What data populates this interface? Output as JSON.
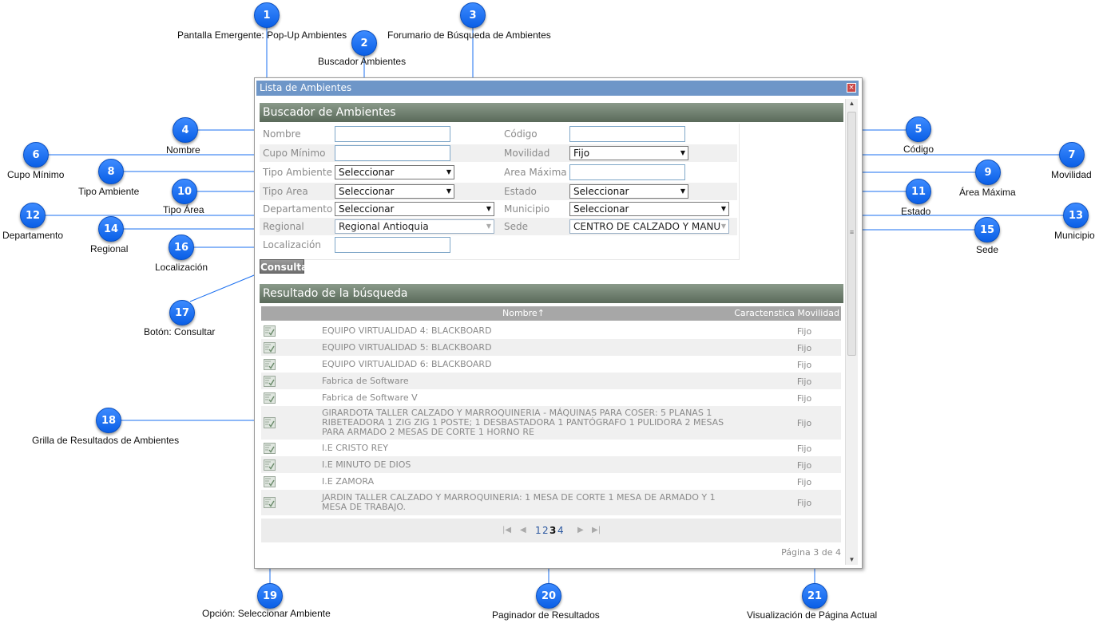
{
  "window": {
    "title": "Lista de Ambientes",
    "close_symbol": "×"
  },
  "search_panel": {
    "title": "Buscador de Ambientes"
  },
  "form": {
    "nombre": {
      "label": "Nombre"
    },
    "codigo": {
      "label": "Código"
    },
    "cupo_minimo": {
      "label": "Cupo Mínimo"
    },
    "movilidad": {
      "label": "Movilidad",
      "value": "Fijo"
    },
    "tipo_ambiente": {
      "label": "Tipo Ambiente",
      "value": "Seleccionar"
    },
    "area_maxima": {
      "label": "Area Máxima"
    },
    "tipo_area": {
      "label": "Tipo Area",
      "value": "Seleccionar"
    },
    "estado": {
      "label": "Estado",
      "value": "Seleccionar"
    },
    "departamento": {
      "label": "Departamento",
      "value": "Seleccionar"
    },
    "municipio": {
      "label": "Municipio",
      "value": "Seleccionar"
    },
    "regional": {
      "label": "Regional",
      "value": "Regional Antioquia"
    },
    "sede": {
      "label": "Sede",
      "value": "CENTRO DE CALZADO Y MANU"
    },
    "localizacion": {
      "label": "Localización"
    }
  },
  "consultar_label": "Consultar",
  "results_panel": {
    "title": "Resultado de la búsqueda"
  },
  "grid": {
    "headers": {
      "nombre": "Nombre↑",
      "movilidad": "Caractenstica Movilidad"
    },
    "rows": [
      {
        "nombre": "EQUIPO VIRTUALIDAD 4: BLACKBOARD",
        "movilidad": "Fijo"
      },
      {
        "nombre": "EQUIPO VIRTUALIDAD 5: BLACKBOARD",
        "movilidad": "Fijo"
      },
      {
        "nombre": "EQUIPO VIRTUALIDAD 6: BLACKBOARD",
        "movilidad": "Fijo"
      },
      {
        "nombre": "Fabrica de Software",
        "movilidad": "Fijo"
      },
      {
        "nombre": "Fabrica de Software V",
        "movilidad": "Fijo"
      },
      {
        "nombre": "GIRARDOTA TALLER CALZADO Y MARROQUINERIA - MÁQUINAS PARA COSER: 5 PLANAS 1 RIBETEADORA 1 ZIG ZIG 1 POSTE; 1 DESBASTADORA 1 PANTÓGRAFO 1 PULIDORA 2 MESAS PARA ARMADO 2 MESAS DE CORTE 1 HORNO RE",
        "movilidad": "Fijo"
      },
      {
        "nombre": "I.E CRISTO REY",
        "movilidad": "Fijo"
      },
      {
        "nombre": "I.E MINUTO DE DIOS",
        "movilidad": "Fijo"
      },
      {
        "nombre": "I.E ZAMORA",
        "movilidad": "Fijo"
      },
      {
        "nombre": "JARDIN TALLER CALZADO Y MARROQUINERIA: 1 MESA DE CORTE 1 MESA DE ARMADO Y 1 MESA DE TRABAJO.",
        "movilidad": "Fijo"
      }
    ]
  },
  "pager": {
    "first": "|◀",
    "prev": "◀",
    "next": "▶",
    "last": "▶|",
    "pages": [
      "1",
      "2",
      "3",
      "4"
    ],
    "current": "3",
    "info": "Página 3 de 4"
  },
  "callouts": [
    {
      "n": "1",
      "text": "Pantalla Emergente: Pop-Up Ambientes"
    },
    {
      "n": "2",
      "text": "Buscador Ambientes"
    },
    {
      "n": "3",
      "text": "Forumario de Búsqueda de Ambientes"
    },
    {
      "n": "4",
      "text": "Nombre"
    },
    {
      "n": "5",
      "text": "Código"
    },
    {
      "n": "6",
      "text": "Cupo Mínimo"
    },
    {
      "n": "7",
      "text": "Movilidad"
    },
    {
      "n": "8",
      "text": "Tipo Ambiente"
    },
    {
      "n": "9",
      "text": "Área Máxima"
    },
    {
      "n": "10",
      "text": "Tipo Área"
    },
    {
      "n": "11",
      "text": "Estado"
    },
    {
      "n": "12",
      "text": "Departamento"
    },
    {
      "n": "13",
      "text": "Municipio"
    },
    {
      "n": "14",
      "text": "Regional"
    },
    {
      "n": "15",
      "text": "Sede"
    },
    {
      "n": "16",
      "text": "Localización"
    },
    {
      "n": "17",
      "text": "Botón: Consultar"
    },
    {
      "n": "18",
      "text": "Grilla de Resultados de Ambientes"
    },
    {
      "n": "19",
      "text": "Opción: Seleccionar Ambiente"
    },
    {
      "n": "20",
      "text": "Paginador de Resultados"
    },
    {
      "n": "21",
      "text": "Visualización de Página Actual"
    }
  ],
  "colors": {
    "titlebar": "#6e96c8",
    "panel_header": "#6a7a6a",
    "badge": "#1a6ff0",
    "link": "#2a57a0"
  }
}
